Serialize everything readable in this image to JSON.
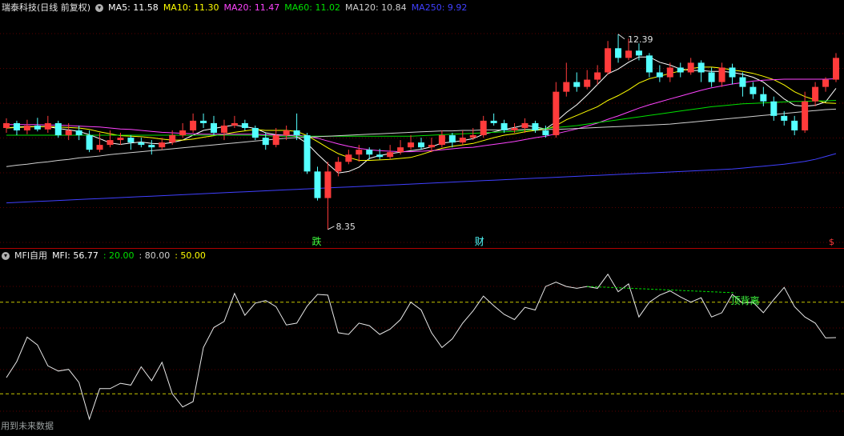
{
  "header": {
    "stock": "瑞泰科技(日线 前复权)",
    "ma_items": [
      {
        "label": "MA5: 11.58",
        "color": "#ffffff"
      },
      {
        "label": "MA10: 11.30",
        "color": "#ffff00"
      },
      {
        "label": "MA20: 11.47",
        "color": "#ff44ff"
      },
      {
        "label": "MA60: 11.02",
        "color": "#00e000"
      },
      {
        "label": "MA120: 10.84",
        "color": "#d0d0d0"
      },
      {
        "label": "MA250: 9.92",
        "color": "#4040ff"
      }
    ]
  },
  "indicator_header": {
    "name": "MFI自用",
    "items": [
      {
        "label": "MFI: 56.77",
        "color": "#ffffff"
      },
      {
        "label": ": 20.00",
        "color": "#00e000"
      },
      {
        "label": ": 80.00",
        "color": "#d0d0d0"
      },
      {
        "label": ": 50.00",
        "color": "#ffff00"
      }
    ]
  },
  "markers": {
    "high": "12.39",
    "low": "8.35",
    "event1": "跌",
    "event2": "财",
    "end": "$"
  },
  "divergence_label": "顶背离",
  "footer": "用到未来数据",
  "chart_data": [
    {
      "type": "candlestick",
      "ylim": [
        8.0,
        12.8
      ],
      "candles": [
        [
          10.45,
          10.55,
          10.65,
          10.35
        ],
        [
          10.55,
          10.4,
          10.6,
          10.3
        ],
        [
          10.4,
          10.5,
          10.62,
          10.32
        ],
        [
          10.5,
          10.42,
          10.66,
          10.38
        ],
        [
          10.42,
          10.55,
          10.7,
          10.35
        ],
        [
          10.55,
          10.3,
          10.6,
          10.25
        ],
        [
          10.3,
          10.4,
          10.55,
          10.2
        ],
        [
          10.4,
          10.3,
          10.5,
          10.2
        ],
        [
          10.3,
          10.0,
          10.4,
          9.95
        ],
        [
          10.0,
          10.1,
          10.35,
          9.95
        ],
        [
          10.1,
          10.2,
          10.4,
          10.05
        ],
        [
          10.2,
          10.25,
          10.35,
          10.1
        ],
        [
          10.25,
          10.15,
          10.3,
          10.0
        ],
        [
          10.15,
          10.1,
          10.25,
          10.05
        ],
        [
          10.1,
          10.05,
          10.2,
          9.9
        ],
        [
          10.05,
          10.15,
          10.25,
          10.0
        ],
        [
          10.15,
          10.3,
          10.4,
          10.1
        ],
        [
          10.3,
          10.4,
          10.55,
          10.25
        ],
        [
          10.4,
          10.6,
          10.75,
          10.35
        ],
        [
          10.6,
          10.55,
          10.75,
          10.45
        ],
        [
          10.55,
          10.35,
          10.7,
          10.3
        ],
        [
          10.35,
          10.5,
          10.62,
          10.2
        ],
        [
          10.5,
          10.55,
          10.7,
          10.45
        ],
        [
          10.55,
          10.45,
          10.62,
          10.4
        ],
        [
          10.45,
          10.25,
          10.5,
          10.2
        ],
        [
          10.25,
          10.1,
          10.35,
          10.0
        ],
        [
          10.1,
          10.3,
          10.45,
          10.05
        ],
        [
          10.3,
          10.4,
          10.5,
          10.2
        ],
        [
          10.4,
          10.3,
          10.75,
          10.2
        ],
        [
          10.3,
          9.55,
          10.35,
          9.5
        ],
        [
          9.55,
          9.0,
          9.65,
          8.95
        ],
        [
          9.0,
          9.55,
          9.75,
          8.35
        ],
        [
          9.55,
          9.75,
          9.85,
          9.45
        ],
        [
          9.75,
          9.9,
          10.0,
          9.7
        ],
        [
          9.9,
          10.0,
          10.1,
          9.75
        ],
        [
          10.0,
          9.9,
          10.05,
          9.8
        ],
        [
          9.9,
          9.85,
          10.02,
          9.8
        ],
        [
          9.85,
          9.95,
          10.1,
          9.8
        ],
        [
          9.95,
          10.05,
          10.2,
          9.9
        ],
        [
          10.05,
          10.15,
          10.3,
          10.0
        ],
        [
          10.15,
          10.05,
          10.25,
          10.0
        ],
        [
          10.05,
          10.1,
          10.25,
          9.95
        ],
        [
          10.1,
          10.3,
          10.4,
          10.05
        ],
        [
          10.3,
          10.15,
          10.35,
          10.05
        ],
        [
          10.15,
          10.25,
          10.4,
          10.1
        ],
        [
          10.25,
          10.3,
          10.45,
          10.2
        ],
        [
          10.3,
          10.6,
          10.7,
          10.25
        ],
        [
          10.6,
          10.55,
          10.75,
          10.5
        ],
        [
          10.55,
          10.4,
          10.62,
          10.35
        ],
        [
          10.4,
          10.45,
          10.55,
          10.35
        ],
        [
          10.45,
          10.55,
          10.65,
          10.35
        ],
        [
          10.55,
          10.4,
          10.6,
          10.35
        ],
        [
          10.4,
          10.3,
          10.5,
          10.25
        ],
        [
          10.3,
          11.2,
          11.4,
          10.25
        ],
        [
          11.2,
          11.4,
          11.8,
          11.1
        ],
        [
          11.4,
          11.3,
          11.6,
          11.2
        ],
        [
          11.3,
          11.45,
          11.65,
          11.25
        ],
        [
          11.45,
          11.6,
          11.75,
          11.35
        ],
        [
          11.6,
          12.1,
          12.25,
          11.55
        ],
        [
          12.1,
          11.9,
          12.39,
          11.8
        ],
        [
          11.9,
          12.05,
          12.3,
          11.85
        ],
        [
          12.05,
          11.95,
          12.2,
          11.85
        ],
        [
          11.95,
          11.6,
          12.0,
          11.5
        ],
        [
          11.6,
          11.5,
          11.75,
          11.4
        ],
        [
          11.5,
          11.7,
          11.8,
          11.4
        ],
        [
          11.7,
          11.6,
          11.8,
          11.5
        ],
        [
          11.6,
          11.8,
          11.9,
          11.55
        ],
        [
          11.8,
          11.6,
          11.85,
          11.4
        ],
        [
          11.6,
          11.4,
          11.7,
          11.3
        ],
        [
          11.4,
          11.7,
          11.8,
          11.3
        ],
        [
          11.7,
          11.5,
          11.78,
          11.35
        ],
        [
          11.5,
          11.3,
          11.6,
          11.1
        ],
        [
          11.3,
          11.15,
          11.4,
          11.05
        ],
        [
          11.15,
          11.0,
          11.3,
          10.9
        ],
        [
          11.0,
          10.7,
          11.1,
          10.6
        ],
        [
          10.7,
          10.6,
          10.8,
          10.5
        ],
        [
          10.6,
          10.4,
          10.7,
          10.3
        ],
        [
          10.4,
          11.0,
          11.2,
          10.35
        ],
        [
          11.0,
          11.3,
          11.4,
          10.9
        ],
        [
          11.3,
          11.45,
          11.5,
          11.2
        ],
        [
          11.45,
          11.9,
          12.0,
          11.4
        ]
      ],
      "ma_lines": [
        {
          "name": "MA5",
          "color": "#ffffff",
          "values": [
            10.45,
            10.47,
            10.48,
            10.48,
            10.48,
            10.44,
            10.41,
            10.38,
            10.31,
            10.23,
            10.14,
            10.11,
            10.14,
            10.16,
            10.13,
            10.12,
            10.15,
            10.2,
            10.3,
            10.4,
            10.44,
            10.48,
            10.51,
            10.48,
            10.44,
            10.35,
            10.31,
            10.3,
            10.27,
            10.13,
            9.91,
            9.71,
            9.52,
            9.55,
            9.64,
            9.82,
            9.88,
            9.92,
            9.95,
            9.98,
            10.01,
            10.06,
            10.14,
            10.16,
            10.19,
            10.23,
            10.32,
            10.37,
            10.42,
            10.46,
            10.51,
            10.47,
            10.43,
            10.58,
            10.77,
            10.93,
            11.13,
            11.35,
            11.57,
            11.67,
            11.81,
            11.92,
            11.92,
            11.81,
            11.75,
            11.67,
            11.64,
            11.64,
            11.62,
            11.62,
            11.6,
            11.56,
            11.5,
            11.4,
            11.23,
            11.05,
            10.92,
            10.9,
            10.92,
            10.99,
            11.27
          ]
        },
        {
          "name": "MA10",
          "color": "#ffff00",
          "values": [
            10.45,
            10.46,
            10.47,
            10.48,
            10.48,
            10.47,
            10.46,
            10.45,
            10.42,
            10.37,
            10.33,
            10.29,
            10.28,
            10.27,
            10.25,
            10.22,
            10.2,
            10.2,
            10.22,
            10.26,
            10.29,
            10.32,
            10.36,
            10.39,
            10.42,
            10.4,
            10.4,
            10.4,
            10.38,
            10.29,
            10.17,
            10.04,
            9.92,
            9.84,
            9.78,
            9.78,
            9.79,
            9.8,
            9.82,
            9.84,
            9.9,
            9.97,
            10.03,
            10.07,
            10.1,
            10.13,
            10.19,
            10.25,
            10.3,
            10.33,
            10.37,
            10.4,
            10.42,
            10.5,
            10.62,
            10.71,
            10.8,
            10.89,
            11.02,
            11.12,
            11.24,
            11.38,
            11.47,
            11.52,
            11.58,
            11.63,
            11.68,
            11.71,
            11.71,
            11.69,
            11.65,
            11.62,
            11.58,
            11.52,
            11.45,
            11.34,
            11.2,
            11.1,
            11.03,
            10.97,
            10.96
          ]
        },
        {
          "name": "MA20",
          "color": "#ff44ff",
          "values": [
            10.52,
            10.52,
            10.52,
            10.52,
            10.51,
            10.51,
            10.5,
            10.49,
            10.48,
            10.47,
            10.45,
            10.43,
            10.42,
            10.4,
            10.38,
            10.36,
            10.35,
            10.34,
            10.33,
            10.32,
            10.32,
            10.32,
            10.32,
            10.32,
            10.32,
            10.31,
            10.3,
            10.3,
            10.3,
            10.28,
            10.24,
            10.18,
            10.12,
            10.07,
            10.03,
            10.0,
            9.98,
            9.97,
            9.96,
            9.96,
            9.97,
            9.98,
            10.0,
            10.02,
            10.04,
            10.05,
            10.08,
            10.11,
            10.14,
            10.17,
            10.21,
            10.25,
            10.28,
            10.33,
            10.38,
            10.43,
            10.49,
            10.55,
            10.63,
            10.7,
            10.78,
            10.86,
            10.93,
            10.99,
            11.05,
            11.11,
            11.17,
            11.23,
            11.28,
            11.32,
            11.36,
            11.39,
            11.42,
            11.44,
            11.45,
            11.46,
            11.46,
            11.46,
            11.46,
            11.46,
            11.47
          ]
        },
        {
          "name": "MA60",
          "color": "#00e000",
          "values": [
            10.3,
            10.3,
            10.3,
            10.3,
            10.3,
            10.3,
            10.3,
            10.3,
            10.3,
            10.3,
            10.3,
            10.3,
            10.3,
            10.3,
            10.3,
            10.3,
            10.3,
            10.3,
            10.3,
            10.3,
            10.3,
            10.3,
            10.3,
            10.3,
            10.3,
            10.29,
            10.28,
            10.28,
            10.28,
            10.28,
            10.28,
            10.28,
            10.28,
            10.28,
            10.28,
            10.28,
            10.28,
            10.28,
            10.28,
            10.28,
            10.29,
            10.3,
            10.31,
            10.32,
            10.33,
            10.34,
            10.35,
            10.36,
            10.37,
            10.38,
            10.4,
            10.42,
            10.44,
            10.46,
            10.48,
            10.5,
            10.53,
            10.56,
            10.59,
            10.62,
            10.65,
            10.68,
            10.71,
            10.74,
            10.77,
            10.8,
            10.83,
            10.86,
            10.89,
            10.91,
            10.93,
            10.95,
            10.96,
            10.97,
            10.98,
            10.99,
            11.0,
            11.0,
            11.01,
            11.01,
            11.02
          ]
        },
        {
          "name": "MA120",
          "color": "#d0d0d0",
          "values": [
            9.65,
            9.68,
            9.7,
            9.73,
            9.75,
            9.78,
            9.8,
            9.83,
            9.85,
            9.87,
            9.9,
            9.92,
            9.94,
            9.96,
            9.98,
            10.0,
            10.02,
            10.04,
            10.06,
            10.08,
            10.1,
            10.12,
            10.14,
            10.16,
            10.18,
            10.2,
            10.22,
            10.24,
            10.25,
            10.26,
            10.27,
            10.28,
            10.29,
            10.3,
            10.31,
            10.32,
            10.33,
            10.34,
            10.35,
            10.36,
            10.37,
            10.38,
            10.39,
            10.39,
            10.4,
            10.4,
            10.41,
            10.41,
            10.41,
            10.41,
            10.42,
            10.42,
            10.42,
            10.42,
            10.43,
            10.44,
            10.45,
            10.46,
            10.47,
            10.48,
            10.49,
            10.5,
            10.51,
            10.52,
            10.53,
            10.55,
            10.57,
            10.59,
            10.61,
            10.63,
            10.65,
            10.67,
            10.69,
            10.71,
            10.73,
            10.75,
            10.77,
            10.79,
            10.81,
            10.83,
            10.84
          ]
        },
        {
          "name": "MA250",
          "color": "#4040ff",
          "values": [
            8.9,
            8.91,
            8.92,
            8.93,
            8.94,
            8.95,
            8.96,
            8.97,
            8.98,
            8.99,
            9.0,
            9.01,
            9.02,
            9.03,
            9.04,
            9.05,
            9.06,
            9.07,
            9.08,
            9.09,
            9.1,
            9.11,
            9.12,
            9.13,
            9.14,
            9.15,
            9.16,
            9.17,
            9.18,
            9.19,
            9.2,
            9.21,
            9.22,
            9.23,
            9.24,
            9.25,
            9.26,
            9.27,
            9.28,
            9.29,
            9.3,
            9.31,
            9.32,
            9.33,
            9.34,
            9.35,
            9.36,
            9.37,
            9.38,
            9.39,
            9.4,
            9.41,
            9.42,
            9.43,
            9.44,
            9.45,
            9.46,
            9.47,
            9.48,
            9.49,
            9.5,
            9.51,
            9.52,
            9.53,
            9.54,
            9.55,
            9.56,
            9.57,
            9.58,
            9.59,
            9.6,
            9.62,
            9.64,
            9.66,
            9.68,
            9.7,
            9.73,
            9.76,
            9.8,
            9.86,
            9.92
          ]
        }
      ]
    },
    {
      "type": "line",
      "ylim": [
        -5,
        105
      ],
      "hlines": [
        {
          "value": 80,
          "color": "#c8c800"
        },
        {
          "value": 20,
          "color": "#c8c800"
        }
      ],
      "series": [
        {
          "name": "MFI",
          "color": "#e8e8e8",
          "values": [
            30.6,
            41.1,
            57.1,
            52.0,
            38.3,
            34.9,
            36.0,
            27.4,
            3.4,
            23.4,
            23.4,
            26.9,
            25.7,
            37.7,
            28.6,
            40.6,
            20.0,
            11.4,
            14.9,
            50.3,
            63.4,
            67.4,
            85.7,
            71.4,
            79.4,
            81.1,
            77.1,
            65.1,
            66.3,
            77.4,
            85.1,
            84.6,
            60.0,
            58.9,
            66.3,
            64.6,
            58.9,
            62.3,
            68.6,
            80.0,
            74.9,
            60.0,
            50.3,
            56.0,
            66.3,
            74.3,
            84.0,
            77.7,
            72.0,
            68.6,
            76.6,
            74.9,
            90.3,
            93.1,
            90.3,
            89.1,
            90.3,
            89.1,
            98.3,
            86.9,
            92.0,
            70.3,
            80.0,
            84.6,
            87.4,
            83.4,
            80.0,
            82.9,
            70.3,
            73.1,
            85.1,
            79.4,
            80.0,
            73.1,
            81.7,
            89.7,
            77.1,
            70.3,
            66.3,
            56.6,
            56.8
          ]
        }
      ]
    }
  ]
}
